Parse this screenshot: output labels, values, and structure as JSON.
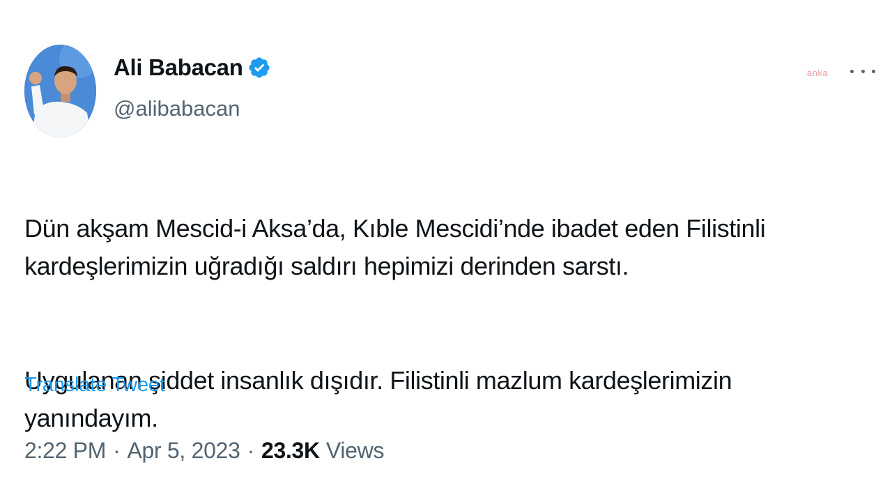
{
  "author": {
    "name": "Ali Babacan",
    "handle": "@alibabacan",
    "verified_color": "#1d9bf0"
  },
  "watermark": "anka",
  "tweet": {
    "paragraph_1": "Dün akşam Mescid-i Aksa’da, Kıble Mescidi’nde ibadet eden Filistinli\nkardeşlerimizin uğradığı saldırı hepimizi derinden sarstı.",
    "paragraph_2": "Uygulanan şiddet insanlık dışıdır. Filistinli mazlum kardeşlerimizin\nyanındayım."
  },
  "translate_label": "Translate Tweet",
  "meta": {
    "time": "2:22 PM",
    "separator": "·",
    "date": "Apr 5, 2023",
    "views_count": "23.3K",
    "views_label": "Views"
  },
  "icons": {
    "more": "more-horizontal-icon",
    "verified": "verified-badge-icon"
  },
  "colors": {
    "link": "#1d9bf0",
    "secondary_text": "#536471",
    "primary_text": "#0f1419"
  }
}
